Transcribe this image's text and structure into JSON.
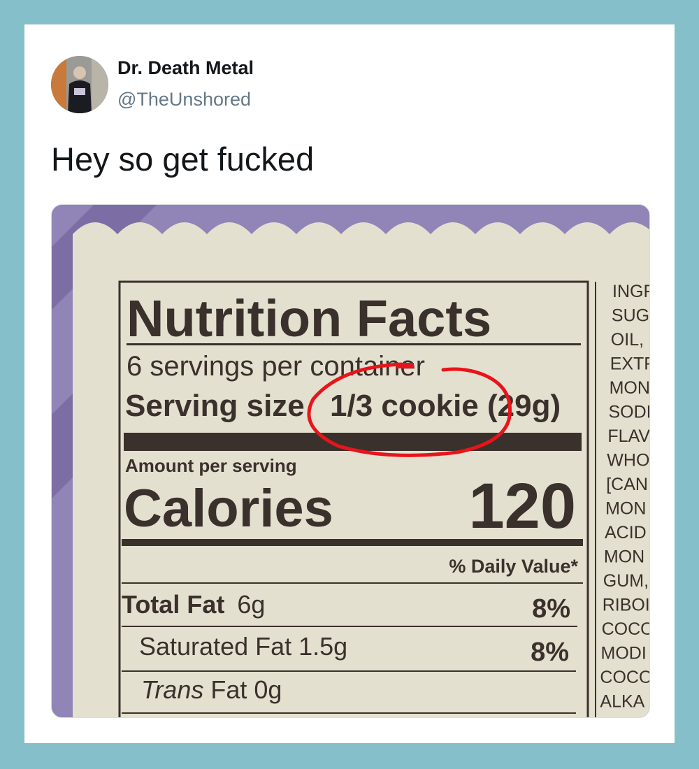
{
  "tweet": {
    "author_name": "Dr. Death Metal",
    "author_handle": "@TheUnshored",
    "text": "Hey so get fucked"
  },
  "label": {
    "title": "Nutrition Facts",
    "servings_per_container": "6 servings per container",
    "serving_size_label": "Serving size",
    "serving_size_value": "1/3 cookie (29g)",
    "amount_per_serving": "Amount per serving",
    "calories_label": "Calories",
    "calories_value": "120",
    "daily_value_header": "% Daily Value*",
    "total_fat_label": "Total Fat",
    "total_fat_amount": "6g",
    "total_fat_dv": "8%",
    "saturated_fat": "Saturated Fat 1.5g",
    "saturated_fat_dv": "8%",
    "trans_fat_word": "Trans",
    "trans_fat_rest": " Fat 0g"
  },
  "ingredients": [
    "INGF",
    "SUGA",
    "OIL,",
    "EXTF",
    "MON",
    "SODI",
    "FLAV",
    "WHO",
    "[CAN",
    "MON",
    "ACID",
    "MON",
    "GUM,",
    "RIBOI",
    "COCO",
    "MODI",
    "COCO,",
    "ALKA"
  ],
  "colors": {
    "annotation_circle": "#e8141b",
    "package_purple": "#9184b6",
    "label_paper": "#e4e0cf",
    "label_ink": "#3a302c"
  }
}
